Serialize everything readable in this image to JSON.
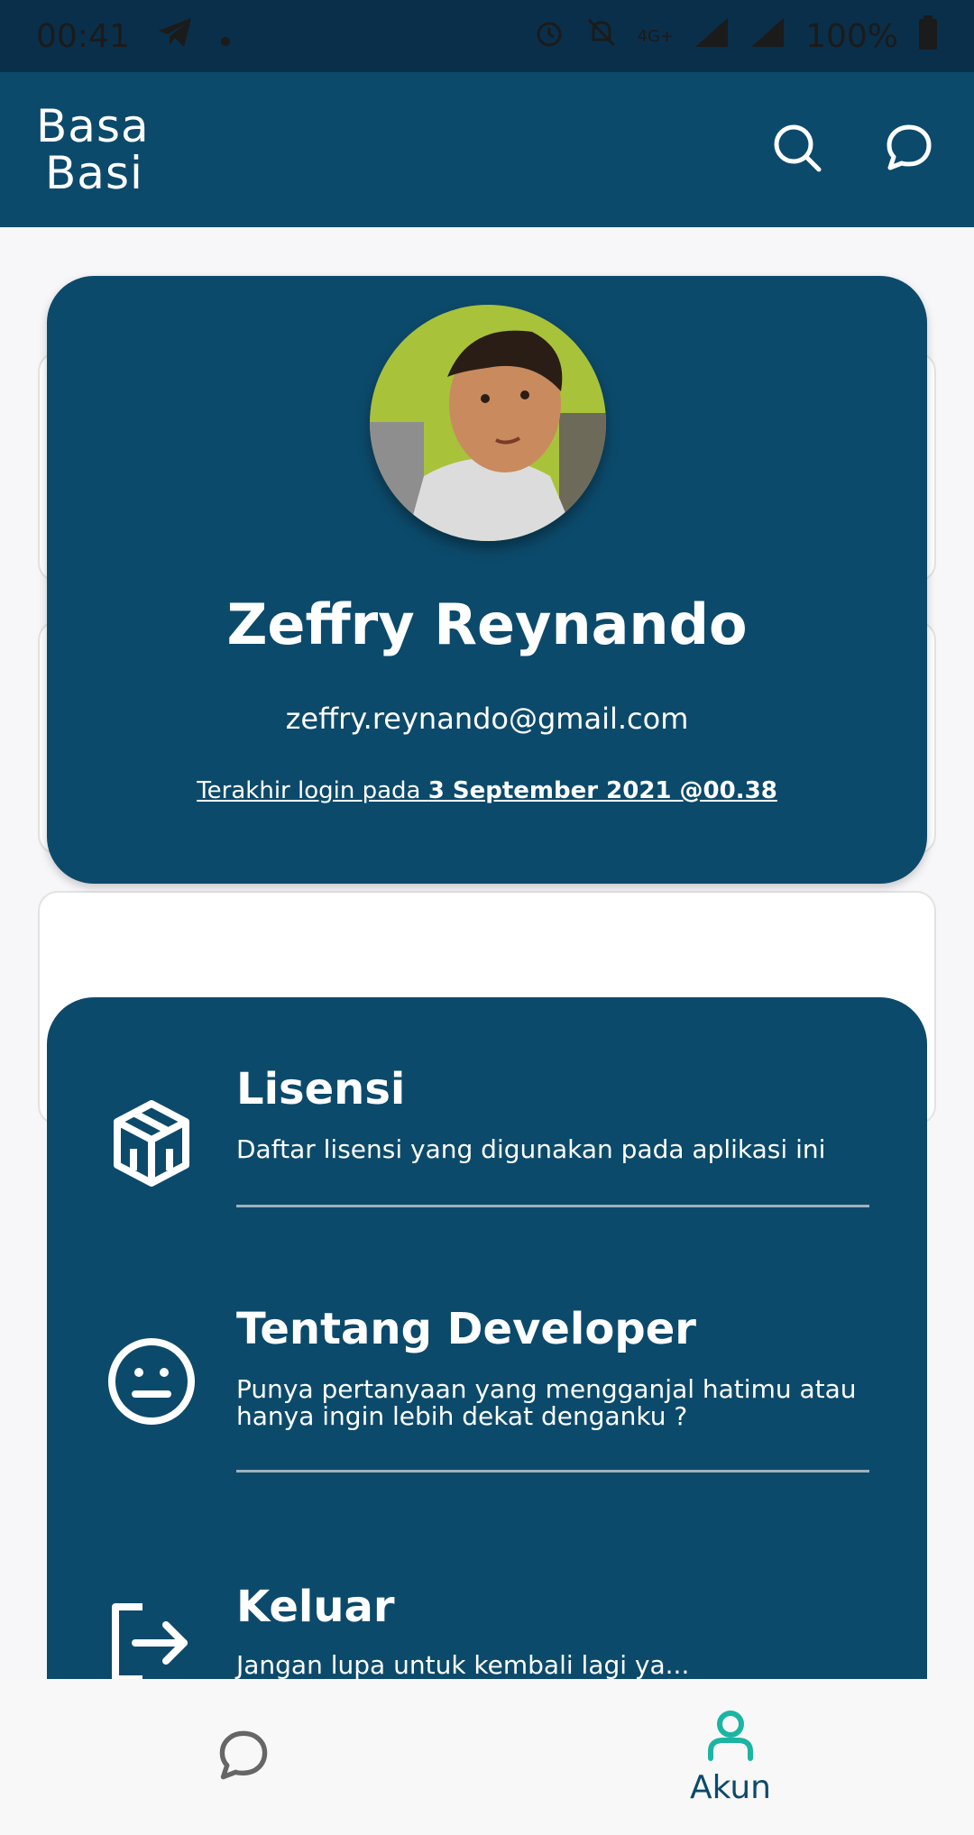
{
  "status_bar": {
    "time": "00:41",
    "battery": "100%",
    "network": "4G+"
  },
  "app_bar": {
    "logo_line1": "Basa",
    "logo_line2": "Basi",
    "icons": [
      "search-icon",
      "chat-icon"
    ]
  },
  "profile": {
    "name": "Zeffry Reynando",
    "email": "zeffry.reynando@gmail.com",
    "last_login_prefix": "Terakhir login pada ",
    "last_login_value": "3 September 2021 @00.38"
  },
  "menu": {
    "items": [
      {
        "icon": "license-box-icon",
        "title": "Lisensi",
        "desc": "Daftar lisensi yang digunakan pada aplikasi ini"
      },
      {
        "icon": "neutral-face-icon",
        "title": "Tentang Developer",
        "desc": "Punya pertanyaan yang mengganjal hatimu atau hanya ingin lebih dekat denganku ?"
      },
      {
        "icon": "logout-icon",
        "title": "Keluar",
        "desc": "Jangan lupa untuk kembali lagi ya..."
      }
    ]
  },
  "bottom_nav": {
    "items": [
      {
        "icon": "chat-icon",
        "label": ""
      },
      {
        "icon": "user-icon",
        "label": "Akun"
      }
    ],
    "active_color": "#1bb5a3"
  },
  "colors": {
    "primary": "#0c4a6b",
    "status_bar": "#0a2f4a",
    "accent": "#1bb5a3"
  }
}
